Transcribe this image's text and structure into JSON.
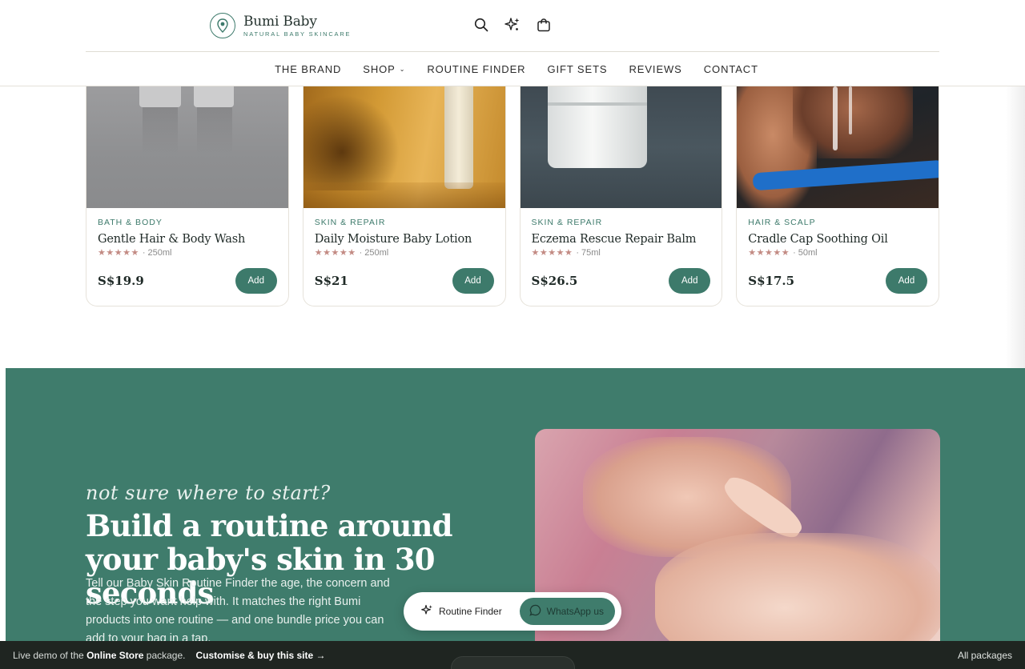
{
  "brand": {
    "name": "Bumi Baby",
    "tagline": "NATURAL BABY SKINCARE",
    "accent": "#3f7c6c"
  },
  "header_icons": [
    "search-icon",
    "sparkle-icon",
    "bag-icon"
  ],
  "nav": [
    {
      "label": "THE BRAND"
    },
    {
      "label": "SHOP",
      "has_dropdown": true
    },
    {
      "label": "ROUTINE FINDER"
    },
    {
      "label": "GIFT SETS"
    },
    {
      "label": "REVIEWS"
    },
    {
      "label": "CONTACT"
    }
  ],
  "products": [
    {
      "category": "BATH & BODY",
      "name": "Gentle Hair & Body Wash",
      "stars": "★★★★★",
      "size": "· 250ml",
      "price": "S$19.9",
      "add_label": "Add"
    },
    {
      "category": "SKIN & REPAIR",
      "name": "Daily Moisture Baby Lotion",
      "stars": "★★★★★",
      "size": "· 250ml",
      "price": "S$21",
      "add_label": "Add"
    },
    {
      "category": "SKIN & REPAIR",
      "name": "Eczema Rescue Repair Balm",
      "stars": "★★★★★",
      "size": "· 75ml",
      "price": "S$26.5",
      "add_label": "Add"
    },
    {
      "category": "HAIR & SCALP",
      "name": "Cradle Cap Soothing Oil",
      "stars": "★★★★★",
      "size": "· 50ml",
      "price": "S$17.5",
      "add_label": "Add"
    }
  ],
  "routine": {
    "kicker": "not sure where to start?",
    "headline": "Build a routine around your baby's skin in 30 seconds",
    "body": "Tell our Baby Skin Routine Finder the age, the concern and the step you want help with. It matches the right Bumi products into one routine — and one bundle price you can add to your bag in a tap."
  },
  "floating": {
    "routine_label": "Routine Finder",
    "whatsapp_label": "WhatsApp us"
  },
  "bottom_bar": {
    "prefix": "Live demo of the",
    "package": "Online Store",
    "suffix": "package.",
    "cta": "Customise & buy this site →",
    "right": "All packages"
  }
}
